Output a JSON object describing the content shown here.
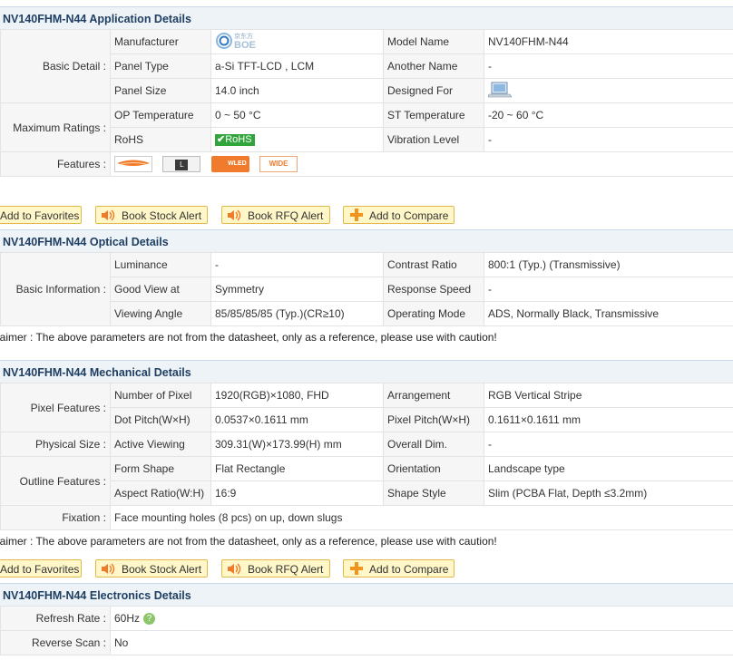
{
  "app": {
    "title": "NV140FHM-N44 Application Details",
    "basic_group": "Basic Detail :",
    "manufacturer_label": "Manufacturer",
    "manufacturer_logo_cn": "京东方",
    "manufacturer_logo_text": "BOE",
    "model_name_label": "Model Name",
    "model_name": "NV140FHM-N44",
    "panel_type_label": "Panel Type",
    "panel_type": "a-Si TFT-LCD , LCM",
    "another_name_label": "Another Name",
    "another_name": "-",
    "panel_size_label": "Panel Size",
    "panel_size": "14.0 inch",
    "designed_for_label": "Designed For",
    "designed_for_icon": "laptop-icon",
    "max_group": "Maximum Ratings :",
    "op_temp_label": "OP Temperature",
    "op_temp": "0 ~ 50 °C",
    "st_temp_label": "ST Temperature",
    "st_temp": "-20 ~ 60 °C",
    "rohs_label": "RoHS",
    "rohs_badge": "RoHS",
    "vibration_label": "Vibration Level",
    "vibration": "-",
    "features_label": "Features :",
    "feature_icons": [
      "backlight-icon",
      "l-icon",
      "wled-icon",
      "wide-icon"
    ],
    "feature_badges": {
      "l": "L",
      "wled": "WLED",
      "wide": "WIDE"
    }
  },
  "buttons": {
    "favorites": "Add to Favorites",
    "stock_alert": "Book Stock Alert",
    "rfq_alert": "Book RFQ Alert",
    "compare": "Add to Compare"
  },
  "optical": {
    "title": "NV140FHM-N44 Optical Details",
    "group": "Basic Information :",
    "luminance_label": "Luminance",
    "luminance": "-",
    "contrast_label": "Contrast Ratio",
    "contrast": "800:1 (Typ.) (Transmissive)",
    "good_view_label": "Good View at",
    "good_view": "Symmetry",
    "response_label": "Response Speed",
    "response": "-",
    "viewing_angle_label": "Viewing Angle",
    "viewing_angle": "85/85/85/85 (Typ.)(CR≥10)",
    "operating_mode_label": "Operating Mode",
    "operating_mode": "ADS, Normally Black, Transmissive"
  },
  "disclaimer": "laimer : The above parameters are not from the datasheet, only as a reference, please use with caution!",
  "mechanical": {
    "title": "NV140FHM-N44 Mechanical Details",
    "pixel_group": "Pixel Features :",
    "num_pixel_label": "Number of Pixel",
    "num_pixel": "1920(RGB)×1080, FHD",
    "arrangement_label": "Arrangement",
    "arrangement": "RGB Vertical Stripe",
    "dot_pitch_label": "Dot Pitch(W×H)",
    "dot_pitch": "0.0537×0.1611 mm",
    "pixel_pitch_label": "Pixel Pitch(W×H)",
    "pixel_pitch": "0.1611×0.1611 mm",
    "physical_group": "Physical Size :",
    "active_label": "Active Viewing",
    "active": "309.31(W)×173.99(H) mm",
    "overall_label": "Overall Dim.",
    "overall": "-",
    "outline_group": "Outline Features :",
    "form_label": "Form Shape",
    "form": "Flat Rectangle",
    "orientation_label": "Orientation",
    "orientation": "Landscape type",
    "aspect_label": "Aspect Ratio(W:H)",
    "aspect": "16:9",
    "shape_style_label": "Shape Style",
    "shape_style": "Slim (PCBA Flat, Depth ≤3.2mm)",
    "fixation_label": "Fixation :",
    "fixation": "Face mounting holes (8 pcs) on up, down slugs"
  },
  "electronics": {
    "title": "NV140FHM-N44 Electronics Details",
    "refresh_label": "Refresh Rate :",
    "refresh": "60Hz",
    "help_icon": "help-icon",
    "reverse_label": "Reverse Scan :",
    "reverse": "No"
  },
  "colors": {
    "header_bg": "#eef3f8",
    "header_text": "#1f3f62",
    "button_bg": "#fff7c8",
    "button_border": "#e0b94a",
    "rohs_green": "#2fa53b"
  }
}
